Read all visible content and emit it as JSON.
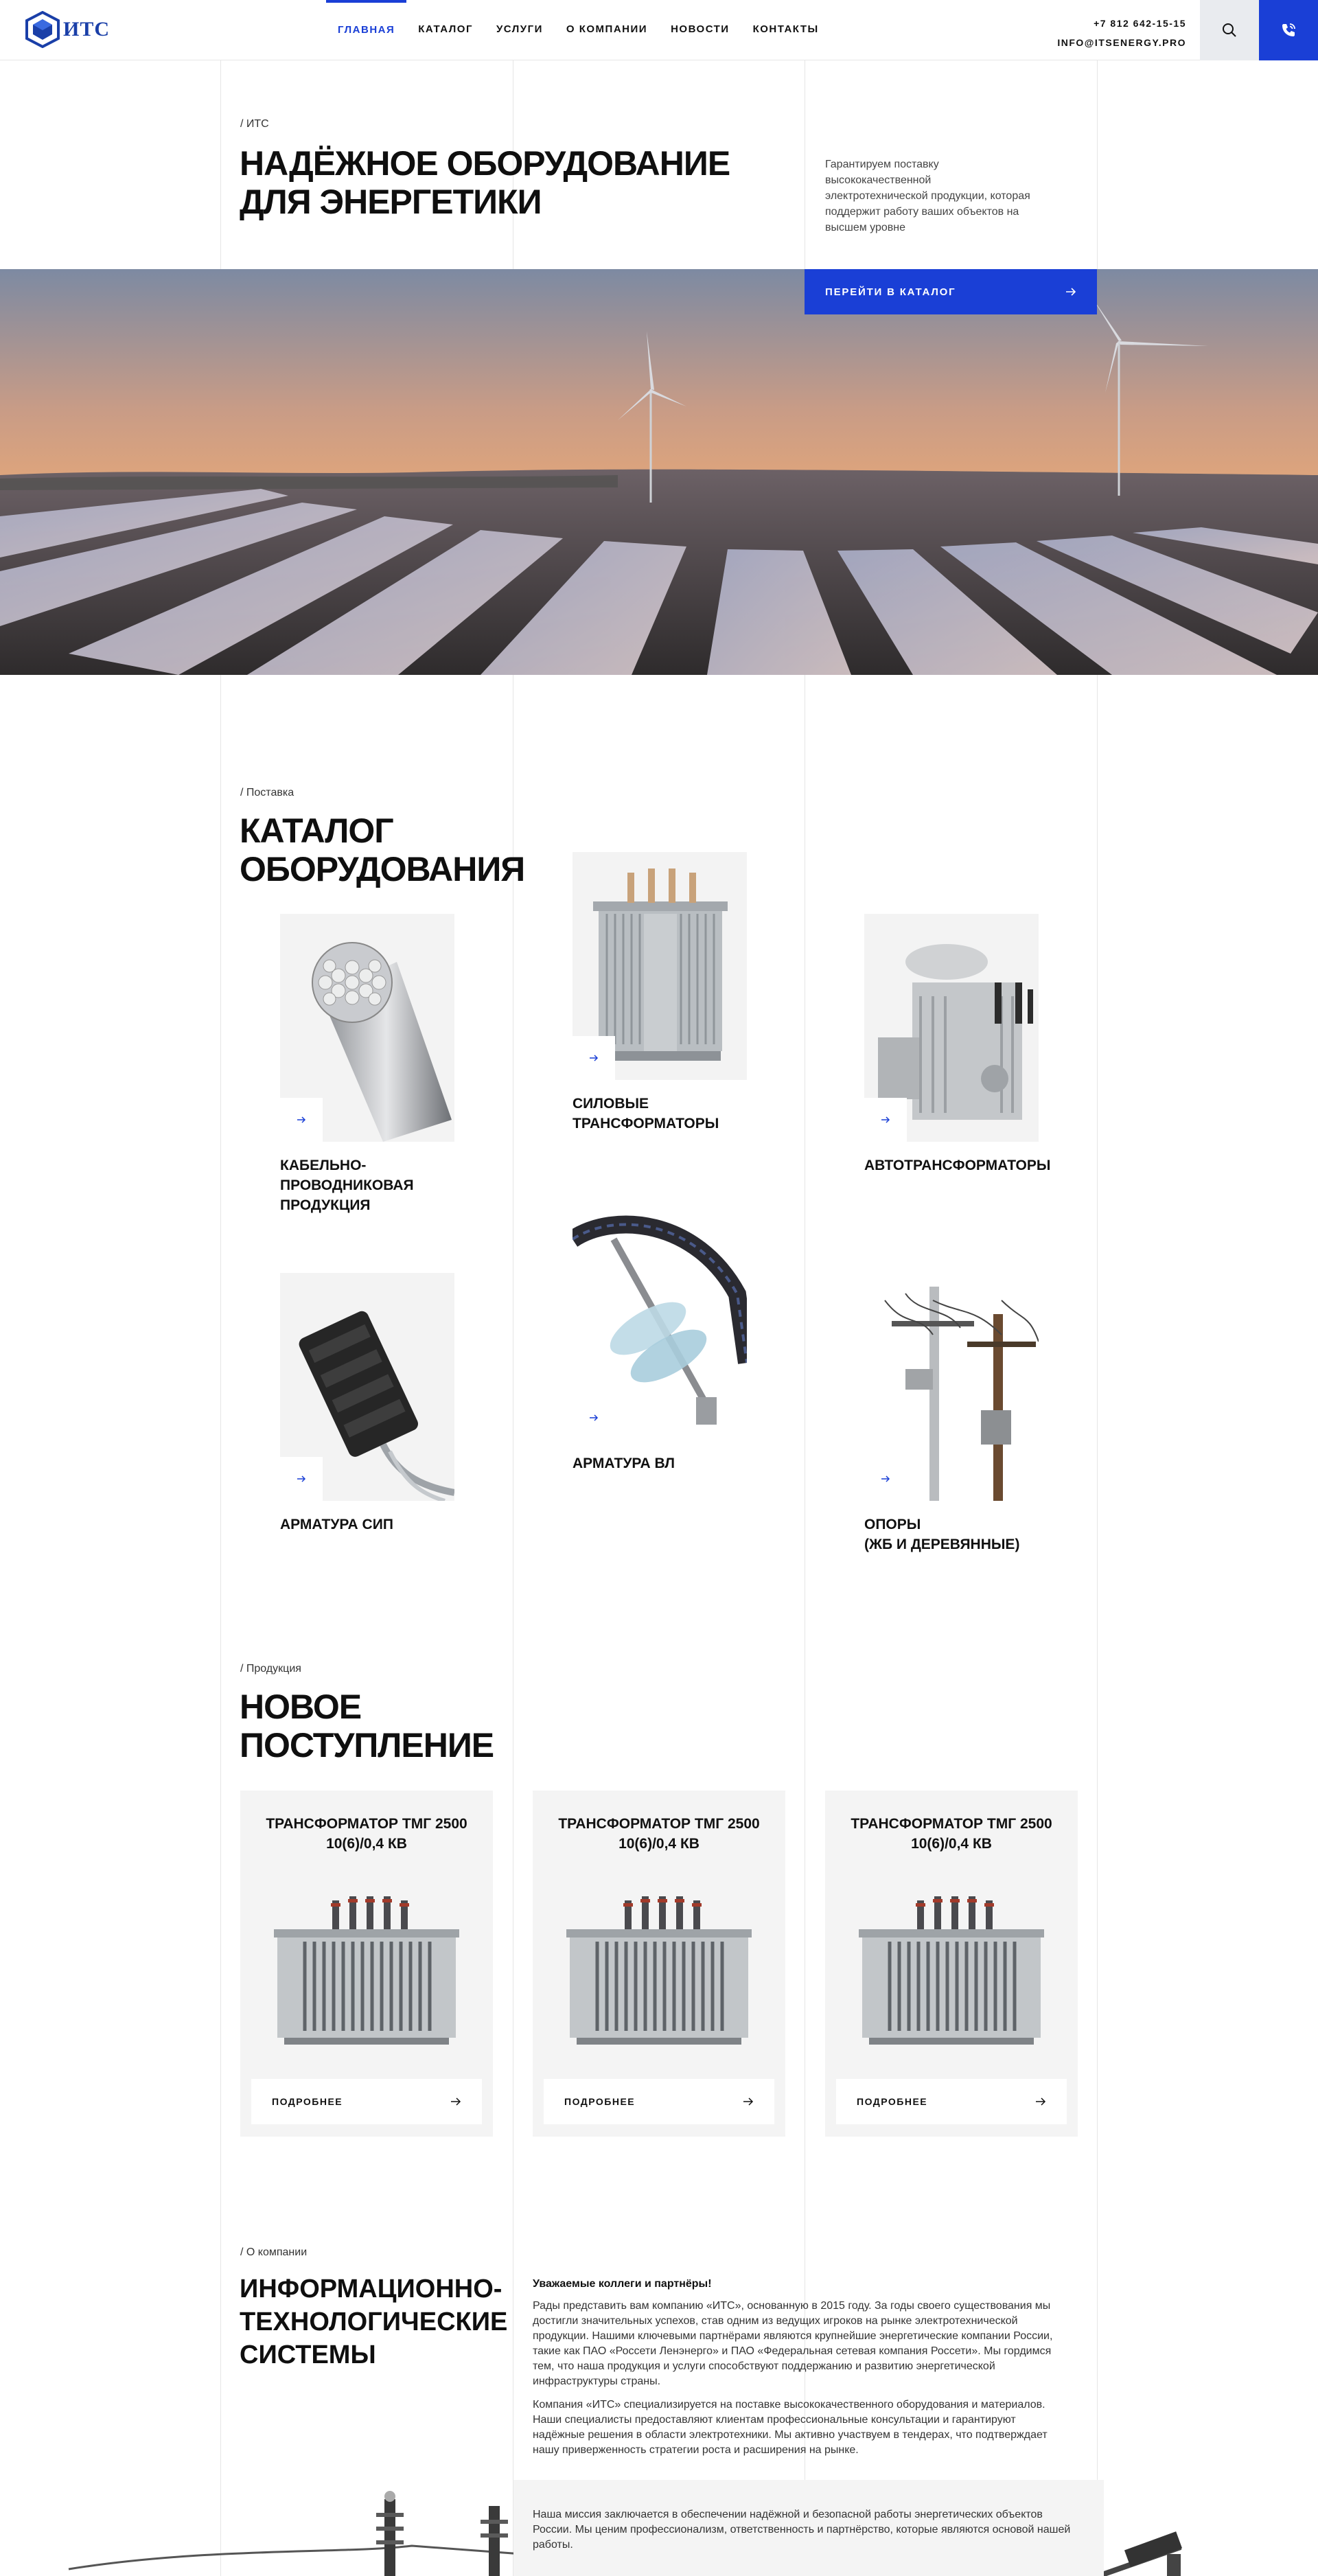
{
  "header": {
    "logo_text": "ИТС",
    "nav": [
      {
        "label": "ГЛАВНАЯ",
        "active": true
      },
      {
        "label": "КАТАЛОГ",
        "active": false
      },
      {
        "label": "УСЛУГИ",
        "active": false
      },
      {
        "label": "О КОМПАНИИ",
        "active": false
      },
      {
        "label": "НОВОСТИ",
        "active": false
      },
      {
        "label": "КОНТАКТЫ",
        "active": false
      }
    ],
    "phone": "+7 812 642-15-15",
    "email": "INFO@ITSENERGY.PRO"
  },
  "hero": {
    "breadcrumb": "/ ИТС",
    "title_line1": "НАДЁЖНОЕ ОБОРУДОВАНИЕ",
    "title_line2": "ДЛЯ ЭНЕРГЕТИКИ",
    "description": "Гарантируем поставку высококачественной электротехнической продукции, которая поддержит работу ваших объектов на высшем уровне",
    "cta_label": "ПЕРЕЙТИ В КАТАЛОГ"
  },
  "catalog": {
    "breadcrumb": "/ Поставка",
    "title_line1": "КАТАЛОГ",
    "title_line2": "ОБОРУДОВАНИЯ",
    "items": [
      {
        "label_line1": "КАБЕЛЬНО-",
        "label_line2": "ПРОВОДНИКОВАЯ",
        "label_line3": "ПРОДУКЦИЯ"
      },
      {
        "label_line1": "СИЛОВЫЕ",
        "label_line2": "ТРАНСФОРМАТОРЫ",
        "label_line3": ""
      },
      {
        "label_line1": "АВТОТРАНСФОРМАТОРЫ",
        "label_line2": "",
        "label_line3": ""
      },
      {
        "label_line1": "АРМАТУРА СИП",
        "label_line2": "",
        "label_line3": ""
      },
      {
        "label_line1": "АРМАТУРА ВЛ",
        "label_line2": "",
        "label_line3": ""
      },
      {
        "label_line1": "ОПОРЫ",
        "label_line2": "(ЖБ И ДЕРЕВЯННЫЕ)",
        "label_line3": ""
      }
    ]
  },
  "products": {
    "breadcrumb": "/ Продукция",
    "title_line1": "НОВОЕ",
    "title_line2": "ПОСТУПЛЕНИЕ",
    "items": [
      {
        "title_line1": "ТРАНСФОРМАТОР ТМГ 2500",
        "title_line2": "10(6)/0,4 КВ",
        "button": "ПОДРОБНЕЕ"
      },
      {
        "title_line1": "ТРАНСФОРМАТОР ТМГ 2500",
        "title_line2": "10(6)/0,4 КВ",
        "button": "ПОДРОБНЕЕ"
      },
      {
        "title_line1": "ТРАНСФОРМАТОР ТМГ 2500",
        "title_line2": "10(6)/0,4 КВ",
        "button": "ПОДРОБНЕЕ"
      }
    ]
  },
  "about": {
    "breadcrumb": "/ О компании",
    "title_line1": "ИНФОРМАЦИОННО-",
    "title_line2": "ТЕХНОЛОГИЧЕСКИЕ",
    "title_line3": "СИСТЕМЫ",
    "greeting": "Уважаемые коллеги и партнёры!",
    "paragraph1": "Рады представить вам компанию «ИТС», основанную в 2015 году. За годы своего существования мы достигли значительных успехов, став одним из ведущих игроков на рынке электротехнической продукции. Нашими ключевыми партнёрами являются крупнейшие энергетические компании России, такие как ПАО «Россети Ленэнерго» и ПАО «Федеральная сетевая компания Россети». Мы гордимся тем, что наша продукция и услуги способствуют поддержанию и развитию энергетической инфраструктуры страны.",
    "paragraph2": "Компания «ИТС» специализируется на поставке высококачественного оборудования и материалов. Наши специалисты предоставляют клиентам профессиональные консультации и гарантируют надёжные решения в области электротехники. Мы активно участвуем в тендерах, что подтверждает нашу приверженность стратегии роста и расширения на рынке.",
    "mission": "Наша миссия заключается в обеспечении надёжной и безопасной работы энергетических объектов России. Мы ценим профессионализм, ответственность и партнёрство, которые являются основой нашей работы."
  }
}
